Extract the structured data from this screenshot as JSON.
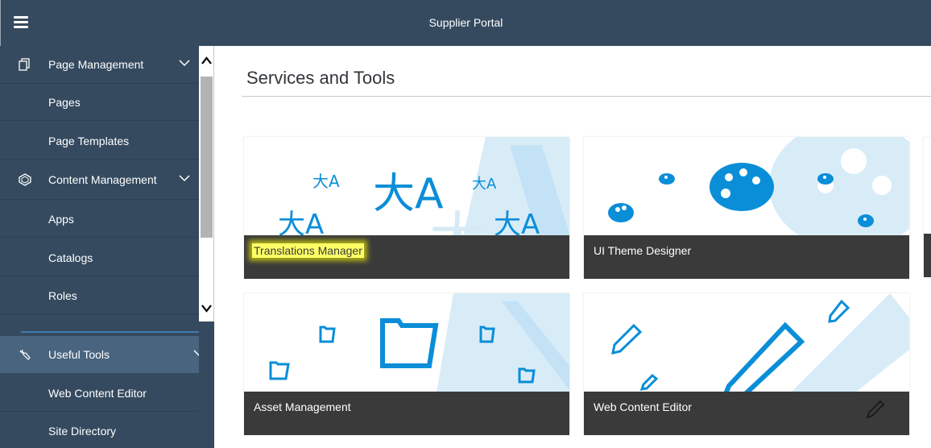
{
  "shell": {
    "title": "Supplier Portal",
    "menu_icon": "hamburger-icon"
  },
  "sidebar": {
    "groups": [
      {
        "label": "Page Management",
        "icon": "page-management-icon",
        "items": [
          "Pages",
          "Page Templates"
        ]
      },
      {
        "label": "Content Management",
        "icon": "content-management-icon",
        "items": [
          "Apps",
          "Catalogs",
          "Roles"
        ]
      },
      {
        "label": "Useful Tools",
        "icon": "wrench-icon",
        "items": [
          "Web Content Editor",
          "Site Directory"
        ]
      }
    ]
  },
  "main": {
    "title": "Services and Tools",
    "tiles": [
      {
        "label": "Translations Manager",
        "icon": "translate-icon",
        "highlighted": true
      },
      {
        "label": "UI Theme Designer",
        "icon": "palette-icon"
      },
      {
        "label": "Asset Management",
        "icon": "folder-icon"
      },
      {
        "label": "Web Content Editor",
        "icon": "pencil-icon"
      }
    ]
  },
  "colors": {
    "shell": "#354a5f",
    "accent": "#0a8ed8",
    "tile_footer": "#3a3a3a",
    "highlight": "#ffff00"
  }
}
